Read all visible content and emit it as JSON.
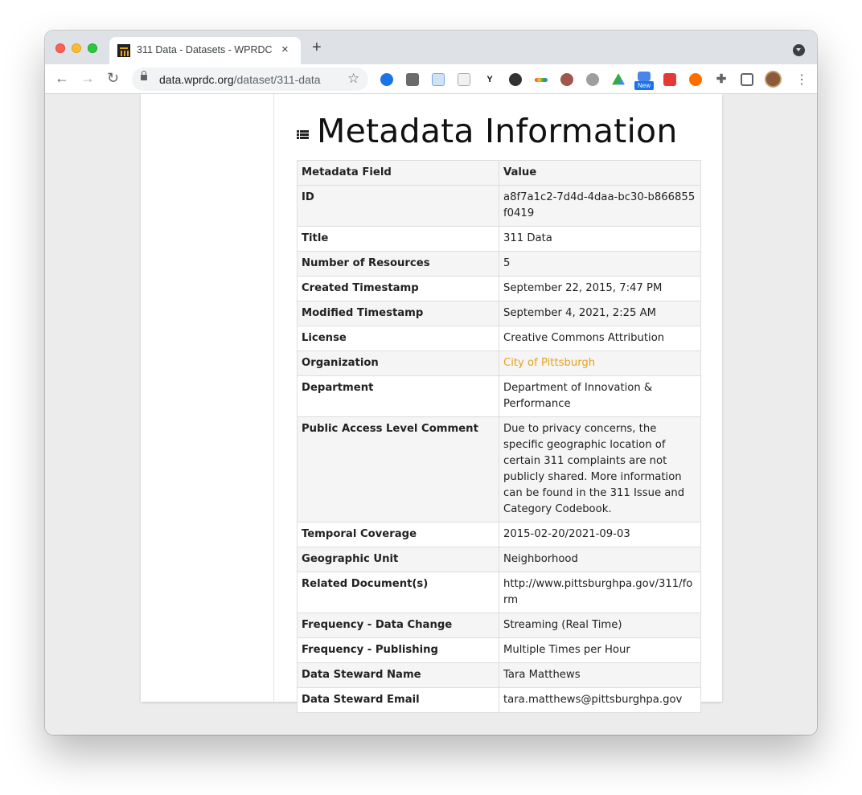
{
  "browser": {
    "tab_title": "311 Data - Datasets - WPRDC",
    "tab_close": "×",
    "new_tab": "+",
    "url_host": "data.wprdc.org",
    "url_path": "/dataset/311-data",
    "extension_badge": "New"
  },
  "page": {
    "heading": "Metadata Information",
    "table": {
      "header_field": "Metadata Field",
      "header_value": "Value",
      "rows": [
        {
          "field": "ID",
          "value": "a8f7a1c2-7d4d-4daa-bc30-b866855f0419"
        },
        {
          "field": "Title",
          "value": "311 Data"
        },
        {
          "field": "Number of Resources",
          "value": "5"
        },
        {
          "field": "Created Timestamp",
          "value": "September 22, 2015, 7:47 PM"
        },
        {
          "field": "Modified Timestamp",
          "value": "September 4, 2021, 2:25 AM"
        },
        {
          "field": "License",
          "value": "Creative Commons Attribution"
        },
        {
          "field": "Organization",
          "value": "City of Pittsburgh"
        },
        {
          "field": "Department",
          "value": "Department of Innovation & Performance"
        },
        {
          "field": "Public Access Level Comment",
          "value": "Due to privacy concerns, the specific geographic location of certain 311 complaints are not publicly shared. More information can be found in the 311 Issue and Category Codebook."
        },
        {
          "field": "Temporal Coverage",
          "value": "2015-02-20/2021-09-03"
        },
        {
          "field": "Geographic Unit",
          "value": "Neighborhood"
        },
        {
          "field": "Related Document(s)",
          "value": "http://www.pittsburghpa.gov/311/form"
        },
        {
          "field": "Frequency - Data Change",
          "value": "Streaming (Real Time)"
        },
        {
          "field": "Frequency - Publishing",
          "value": "Multiple Times per Hour"
        },
        {
          "field": "Data Steward Name",
          "value": "Tara Matthews"
        },
        {
          "field": "Data Steward Email",
          "value": "tara.matthews@pittsburghpa.gov"
        }
      ]
    }
  },
  "colors": {
    "link": "#e8a21b",
    "table_stripe": "#f5f5f5",
    "border": "#dddddd"
  }
}
